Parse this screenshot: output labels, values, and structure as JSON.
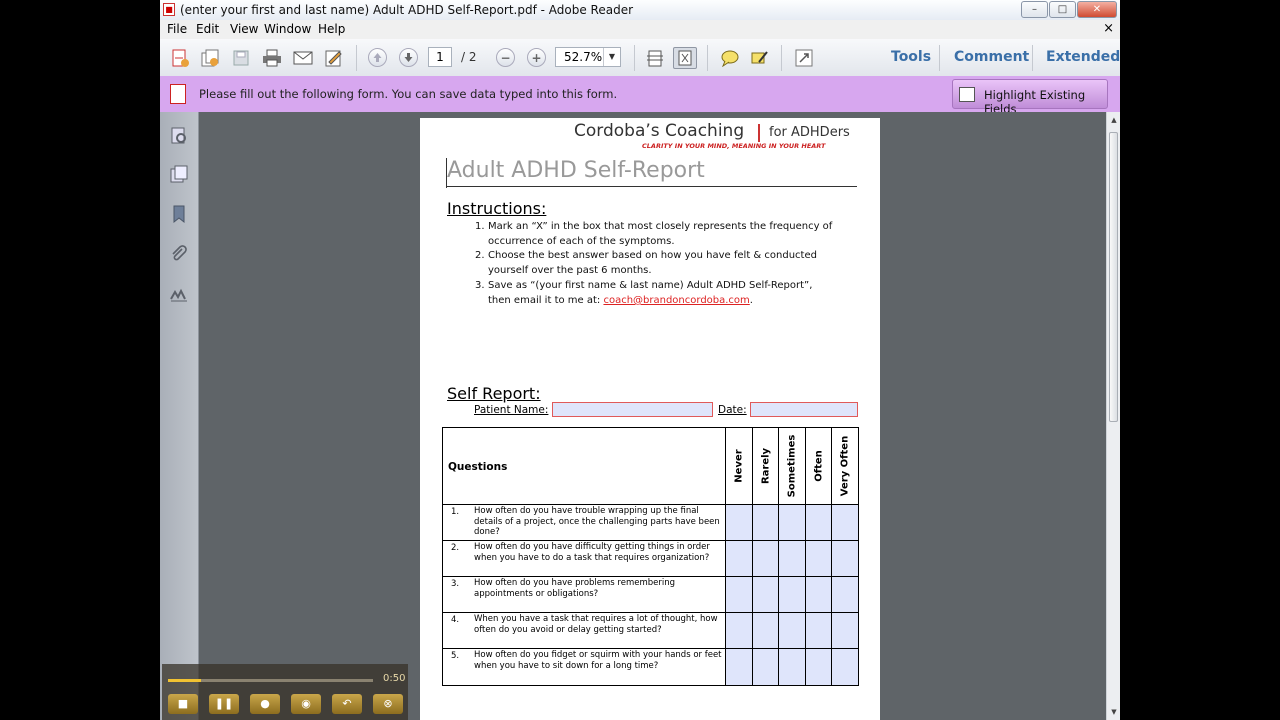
{
  "window": {
    "title": "(enter your first and last name) Adult ADHD Self-Report.pdf - Adobe Reader",
    "app_icon": "pdf-icon",
    "controls": {
      "minimize": "–",
      "maximize": "□",
      "close": "✕"
    }
  },
  "menubar": {
    "items": [
      "File",
      "Edit",
      "View",
      "Window",
      "Help"
    ],
    "doc_close": "×"
  },
  "toolbar": {
    "icons": [
      "create-icon",
      "files-icon",
      "save-icon",
      "print-icon",
      "email-icon",
      "sign-icon",
      "prev-page-icon",
      "next-page-icon"
    ],
    "page_current": "1",
    "page_total": "/ 2",
    "zoom_out": "−",
    "zoom_in": "+",
    "zoom": "52.7%",
    "zoom_dropdown": "▼",
    "right_links": [
      "Tools",
      "Comment",
      "Extended"
    ]
  },
  "formbar": {
    "message": "Please fill out the following form. You can save data typed into this form.",
    "highlight_button": "Highlight Existing Fields"
  },
  "leftnav": {
    "icons": [
      "find-icon",
      "pages-icon",
      "bookmark-icon",
      "attachment-icon",
      "signature-icon"
    ]
  },
  "document": {
    "brand": "Cordoba’s Coaching",
    "brand_sub": "for ADHDers",
    "tagline": "CLARITY IN YOUR MIND, MEANING IN YOUR HEART",
    "title": "Adult ADHD Self-Report",
    "instructions_heading": "Instructions:",
    "instructions": [
      {
        "num": "1.",
        "line1": "Mark an “X” in the box that most closely represents the frequency of",
        "line2": "occurrence of each of the symptoms."
      },
      {
        "num": "2.",
        "line1": "Choose the best answer based on how you have felt & conducted",
        "line2": "yourself over the past 6 months."
      },
      {
        "num": "3.",
        "line1": "Save as “(your first name & last name) Adult ADHD Self-Report”,",
        "line2_prefix": "then email it to me at: ",
        "email": "coach@brandoncordoba.com",
        "line2_suffix": "."
      }
    ],
    "self_report_heading": "Self Report:",
    "patient_name_label": "Patient Name:",
    "date_label": "Date:",
    "table": {
      "questions_header": "Questions",
      "columns": [
        "Never",
        "Rarely",
        "Sometimes",
        "Often",
        "Very Often"
      ],
      "rows": [
        {
          "num": "1.",
          "text": "How often do you have trouble wrapping up the final details of a project, once the challenging parts have been done?"
        },
        {
          "num": "2.",
          "text": "How often do you have difficulty getting things in order when you have to do a task that requires organization?"
        },
        {
          "num": "3.",
          "text": "How often do you have problems remembering appointments or obligations?"
        },
        {
          "num": "4.",
          "text": "When you have a task that requires a lot of thought, how often do you avoid or delay getting started?"
        },
        {
          "num": "5.",
          "text": "How often do you fidget or squirm with your hands or feet when you have to sit down for a long time?"
        }
      ]
    }
  },
  "video": {
    "time": "0:50",
    "progress": 0.16,
    "buttons": [
      "stop-icon",
      "pause-icon",
      "microphone-icon",
      "webcam-icon",
      "undo-icon",
      "cancel-icon"
    ]
  }
}
